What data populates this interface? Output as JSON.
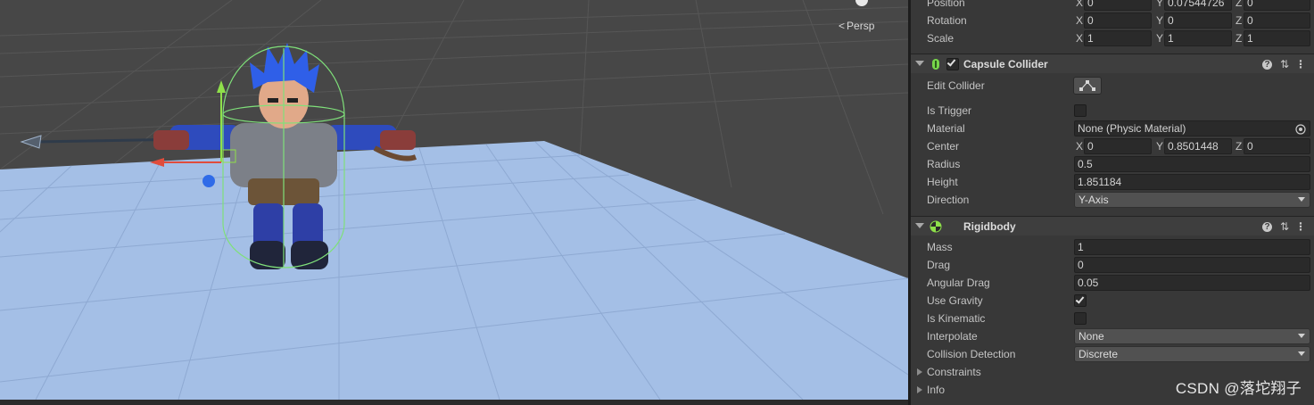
{
  "scene": {
    "camera_mode_label": "Persp",
    "ground_color": "#a4bfe6",
    "background_color": "#474747"
  },
  "transform": {
    "position": {
      "label": "Position",
      "x": "0",
      "y": "0.07544726",
      "z": "0"
    },
    "rotation": {
      "label": "Rotation",
      "x": "0",
      "y": "0",
      "z": "0"
    },
    "scale": {
      "label": "Scale",
      "x": "1",
      "y": "1",
      "z": "1"
    }
  },
  "axes": {
    "x": "X",
    "y": "Y",
    "z": "Z"
  },
  "capsule_collider": {
    "title": "Capsule Collider",
    "enabled": true,
    "edit_collider_label": "Edit Collider",
    "is_trigger_label": "Is Trigger",
    "is_trigger": false,
    "material_label": "Material",
    "material_value": "None (Physic Material)",
    "center_label": "Center",
    "center": {
      "x": "0",
      "y": "0.8501448",
      "z": "0"
    },
    "radius_label": "Radius",
    "radius": "0.5",
    "height_label": "Height",
    "height": "1.851184",
    "direction_label": "Direction",
    "direction": "Y-Axis"
  },
  "rigidbody": {
    "title": "Rigidbody",
    "mass_label": "Mass",
    "mass": "1",
    "drag_label": "Drag",
    "drag": "0",
    "angular_drag_label": "Angular Drag",
    "angular_drag": "0.05",
    "use_gravity_label": "Use Gravity",
    "use_gravity": true,
    "is_kinematic_label": "Is Kinematic",
    "is_kinematic": false,
    "interpolate_label": "Interpolate",
    "interpolate": "None",
    "collision_detection_label": "Collision Detection",
    "collision_detection": "Discrete",
    "constraints_label": "Constraints",
    "info_label": "Info"
  },
  "header_icons": {
    "help": "help-icon",
    "presets": "presets-icon",
    "menu": "kebab-menu-icon"
  },
  "watermark": "CSDN @落坨翔子"
}
